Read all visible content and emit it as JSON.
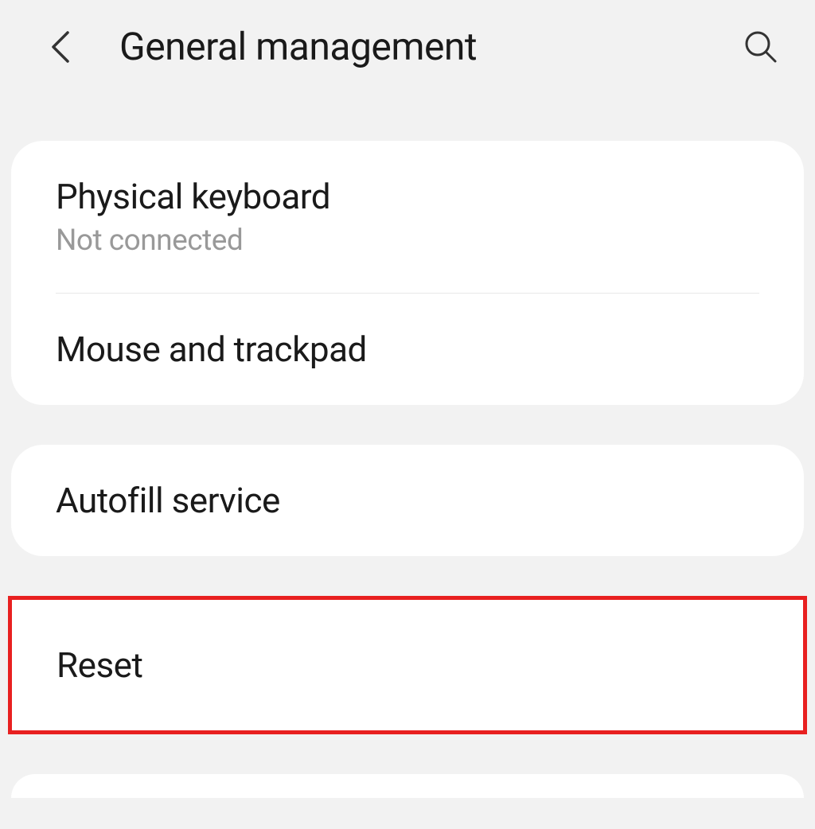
{
  "header": {
    "title": "General management"
  },
  "sections": {
    "group1": {
      "physical_keyboard": {
        "title": "Physical keyboard",
        "subtitle": "Not connected"
      },
      "mouse_trackpad": {
        "title": "Mouse and trackpad"
      }
    },
    "group2": {
      "autofill": {
        "title": "Autofill service"
      }
    },
    "group3": {
      "reset": {
        "title": "Reset"
      }
    }
  }
}
